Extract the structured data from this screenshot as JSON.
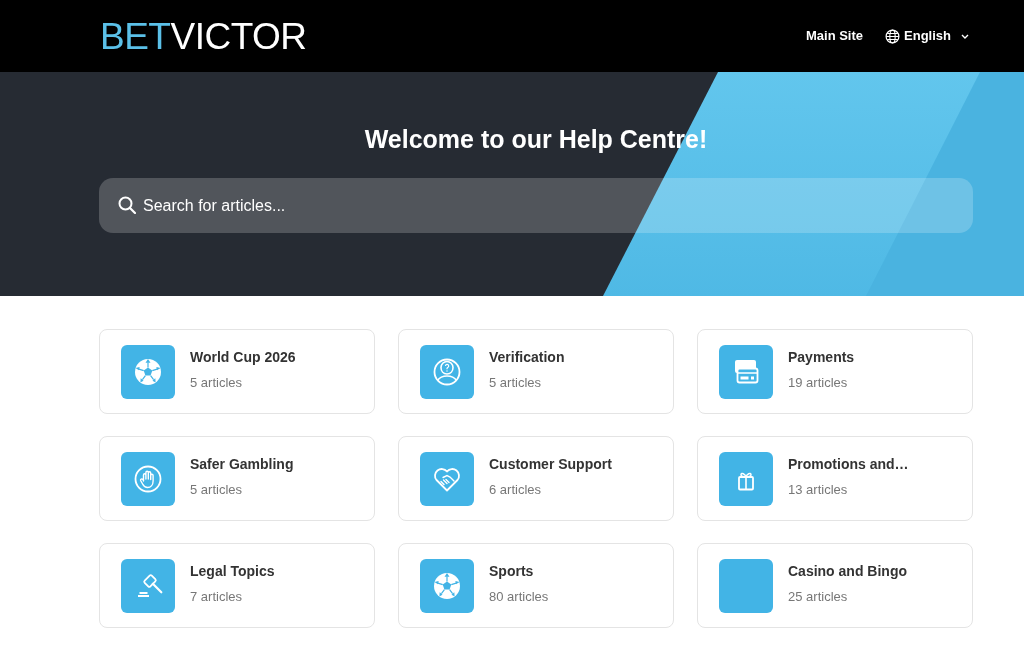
{
  "header": {
    "logo": {
      "accent": "BET",
      "rest": "VICTOR"
    },
    "links": [
      {
        "label": "Main Site"
      }
    ],
    "language": {
      "label": "English"
    }
  },
  "hero": {
    "title": "Welcome to our Help Centre!",
    "search": {
      "placeholder": "Search for articles..."
    }
  },
  "categories": [
    {
      "kind": "ball",
      "title": "World Cup 2026",
      "count": "5 articles"
    },
    {
      "kind": "person",
      "title": "Verification",
      "count": "5 articles"
    },
    {
      "kind": "payment",
      "title": "Payments",
      "count": "19 articles"
    },
    {
      "kind": "hand",
      "title": "Safer Gambling",
      "count": "5 articles"
    },
    {
      "kind": "handshake",
      "title": "Customer Support",
      "count": "6 articles"
    },
    {
      "kind": "gift",
      "title": "Promotions and…",
      "count": "13 articles"
    },
    {
      "kind": "gavel",
      "title": "Legal Topics",
      "count": "7 articles"
    },
    {
      "kind": "ball",
      "title": "Sports",
      "count": "80 articles"
    },
    {
      "kind": "blank",
      "title": "Casino and Bingo",
      "count": "25 articles"
    }
  ]
}
